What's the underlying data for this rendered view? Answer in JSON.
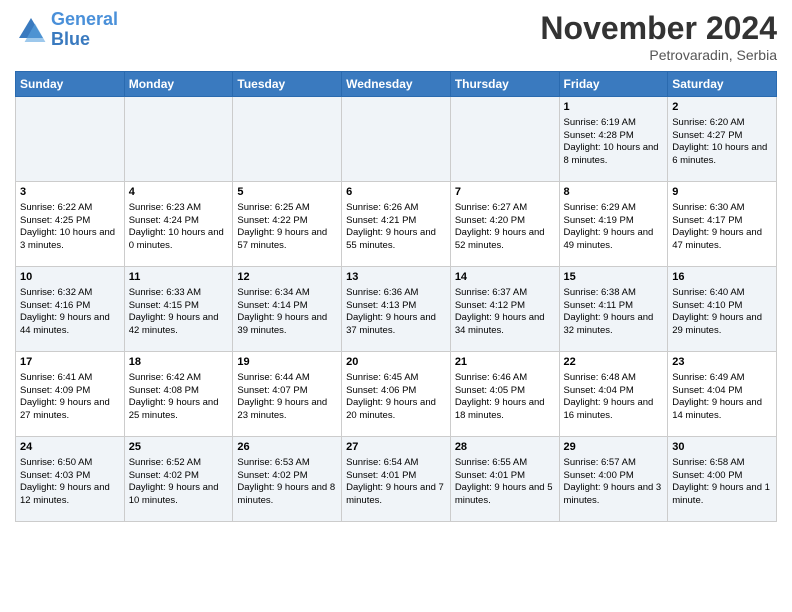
{
  "header": {
    "logo_line1": "General",
    "logo_line2": "Blue",
    "month": "November 2024",
    "location": "Petrovaradin, Serbia"
  },
  "days_of_week": [
    "Sunday",
    "Monday",
    "Tuesday",
    "Wednesday",
    "Thursday",
    "Friday",
    "Saturday"
  ],
  "weeks": [
    [
      {
        "day": "",
        "info": ""
      },
      {
        "day": "",
        "info": ""
      },
      {
        "day": "",
        "info": ""
      },
      {
        "day": "",
        "info": ""
      },
      {
        "day": "",
        "info": ""
      },
      {
        "day": "1",
        "info": "Sunrise: 6:19 AM\nSunset: 4:28 PM\nDaylight: 10 hours and 8 minutes."
      },
      {
        "day": "2",
        "info": "Sunrise: 6:20 AM\nSunset: 4:27 PM\nDaylight: 10 hours and 6 minutes."
      }
    ],
    [
      {
        "day": "3",
        "info": "Sunrise: 6:22 AM\nSunset: 4:25 PM\nDaylight: 10 hours and 3 minutes."
      },
      {
        "day": "4",
        "info": "Sunrise: 6:23 AM\nSunset: 4:24 PM\nDaylight: 10 hours and 0 minutes."
      },
      {
        "day": "5",
        "info": "Sunrise: 6:25 AM\nSunset: 4:22 PM\nDaylight: 9 hours and 57 minutes."
      },
      {
        "day": "6",
        "info": "Sunrise: 6:26 AM\nSunset: 4:21 PM\nDaylight: 9 hours and 55 minutes."
      },
      {
        "day": "7",
        "info": "Sunrise: 6:27 AM\nSunset: 4:20 PM\nDaylight: 9 hours and 52 minutes."
      },
      {
        "day": "8",
        "info": "Sunrise: 6:29 AM\nSunset: 4:19 PM\nDaylight: 9 hours and 49 minutes."
      },
      {
        "day": "9",
        "info": "Sunrise: 6:30 AM\nSunset: 4:17 PM\nDaylight: 9 hours and 47 minutes."
      }
    ],
    [
      {
        "day": "10",
        "info": "Sunrise: 6:32 AM\nSunset: 4:16 PM\nDaylight: 9 hours and 44 minutes."
      },
      {
        "day": "11",
        "info": "Sunrise: 6:33 AM\nSunset: 4:15 PM\nDaylight: 9 hours and 42 minutes."
      },
      {
        "day": "12",
        "info": "Sunrise: 6:34 AM\nSunset: 4:14 PM\nDaylight: 9 hours and 39 minutes."
      },
      {
        "day": "13",
        "info": "Sunrise: 6:36 AM\nSunset: 4:13 PM\nDaylight: 9 hours and 37 minutes."
      },
      {
        "day": "14",
        "info": "Sunrise: 6:37 AM\nSunset: 4:12 PM\nDaylight: 9 hours and 34 minutes."
      },
      {
        "day": "15",
        "info": "Sunrise: 6:38 AM\nSunset: 4:11 PM\nDaylight: 9 hours and 32 minutes."
      },
      {
        "day": "16",
        "info": "Sunrise: 6:40 AM\nSunset: 4:10 PM\nDaylight: 9 hours and 29 minutes."
      }
    ],
    [
      {
        "day": "17",
        "info": "Sunrise: 6:41 AM\nSunset: 4:09 PM\nDaylight: 9 hours and 27 minutes."
      },
      {
        "day": "18",
        "info": "Sunrise: 6:42 AM\nSunset: 4:08 PM\nDaylight: 9 hours and 25 minutes."
      },
      {
        "day": "19",
        "info": "Sunrise: 6:44 AM\nSunset: 4:07 PM\nDaylight: 9 hours and 23 minutes."
      },
      {
        "day": "20",
        "info": "Sunrise: 6:45 AM\nSunset: 4:06 PM\nDaylight: 9 hours and 20 minutes."
      },
      {
        "day": "21",
        "info": "Sunrise: 6:46 AM\nSunset: 4:05 PM\nDaylight: 9 hours and 18 minutes."
      },
      {
        "day": "22",
        "info": "Sunrise: 6:48 AM\nSunset: 4:04 PM\nDaylight: 9 hours and 16 minutes."
      },
      {
        "day": "23",
        "info": "Sunrise: 6:49 AM\nSunset: 4:04 PM\nDaylight: 9 hours and 14 minutes."
      }
    ],
    [
      {
        "day": "24",
        "info": "Sunrise: 6:50 AM\nSunset: 4:03 PM\nDaylight: 9 hours and 12 minutes."
      },
      {
        "day": "25",
        "info": "Sunrise: 6:52 AM\nSunset: 4:02 PM\nDaylight: 9 hours and 10 minutes."
      },
      {
        "day": "26",
        "info": "Sunrise: 6:53 AM\nSunset: 4:02 PM\nDaylight: 9 hours and 8 minutes."
      },
      {
        "day": "27",
        "info": "Sunrise: 6:54 AM\nSunset: 4:01 PM\nDaylight: 9 hours and 7 minutes."
      },
      {
        "day": "28",
        "info": "Sunrise: 6:55 AM\nSunset: 4:01 PM\nDaylight: 9 hours and 5 minutes."
      },
      {
        "day": "29",
        "info": "Sunrise: 6:57 AM\nSunset: 4:00 PM\nDaylight: 9 hours and 3 minutes."
      },
      {
        "day": "30",
        "info": "Sunrise: 6:58 AM\nSunset: 4:00 PM\nDaylight: 9 hours and 1 minute."
      }
    ]
  ]
}
